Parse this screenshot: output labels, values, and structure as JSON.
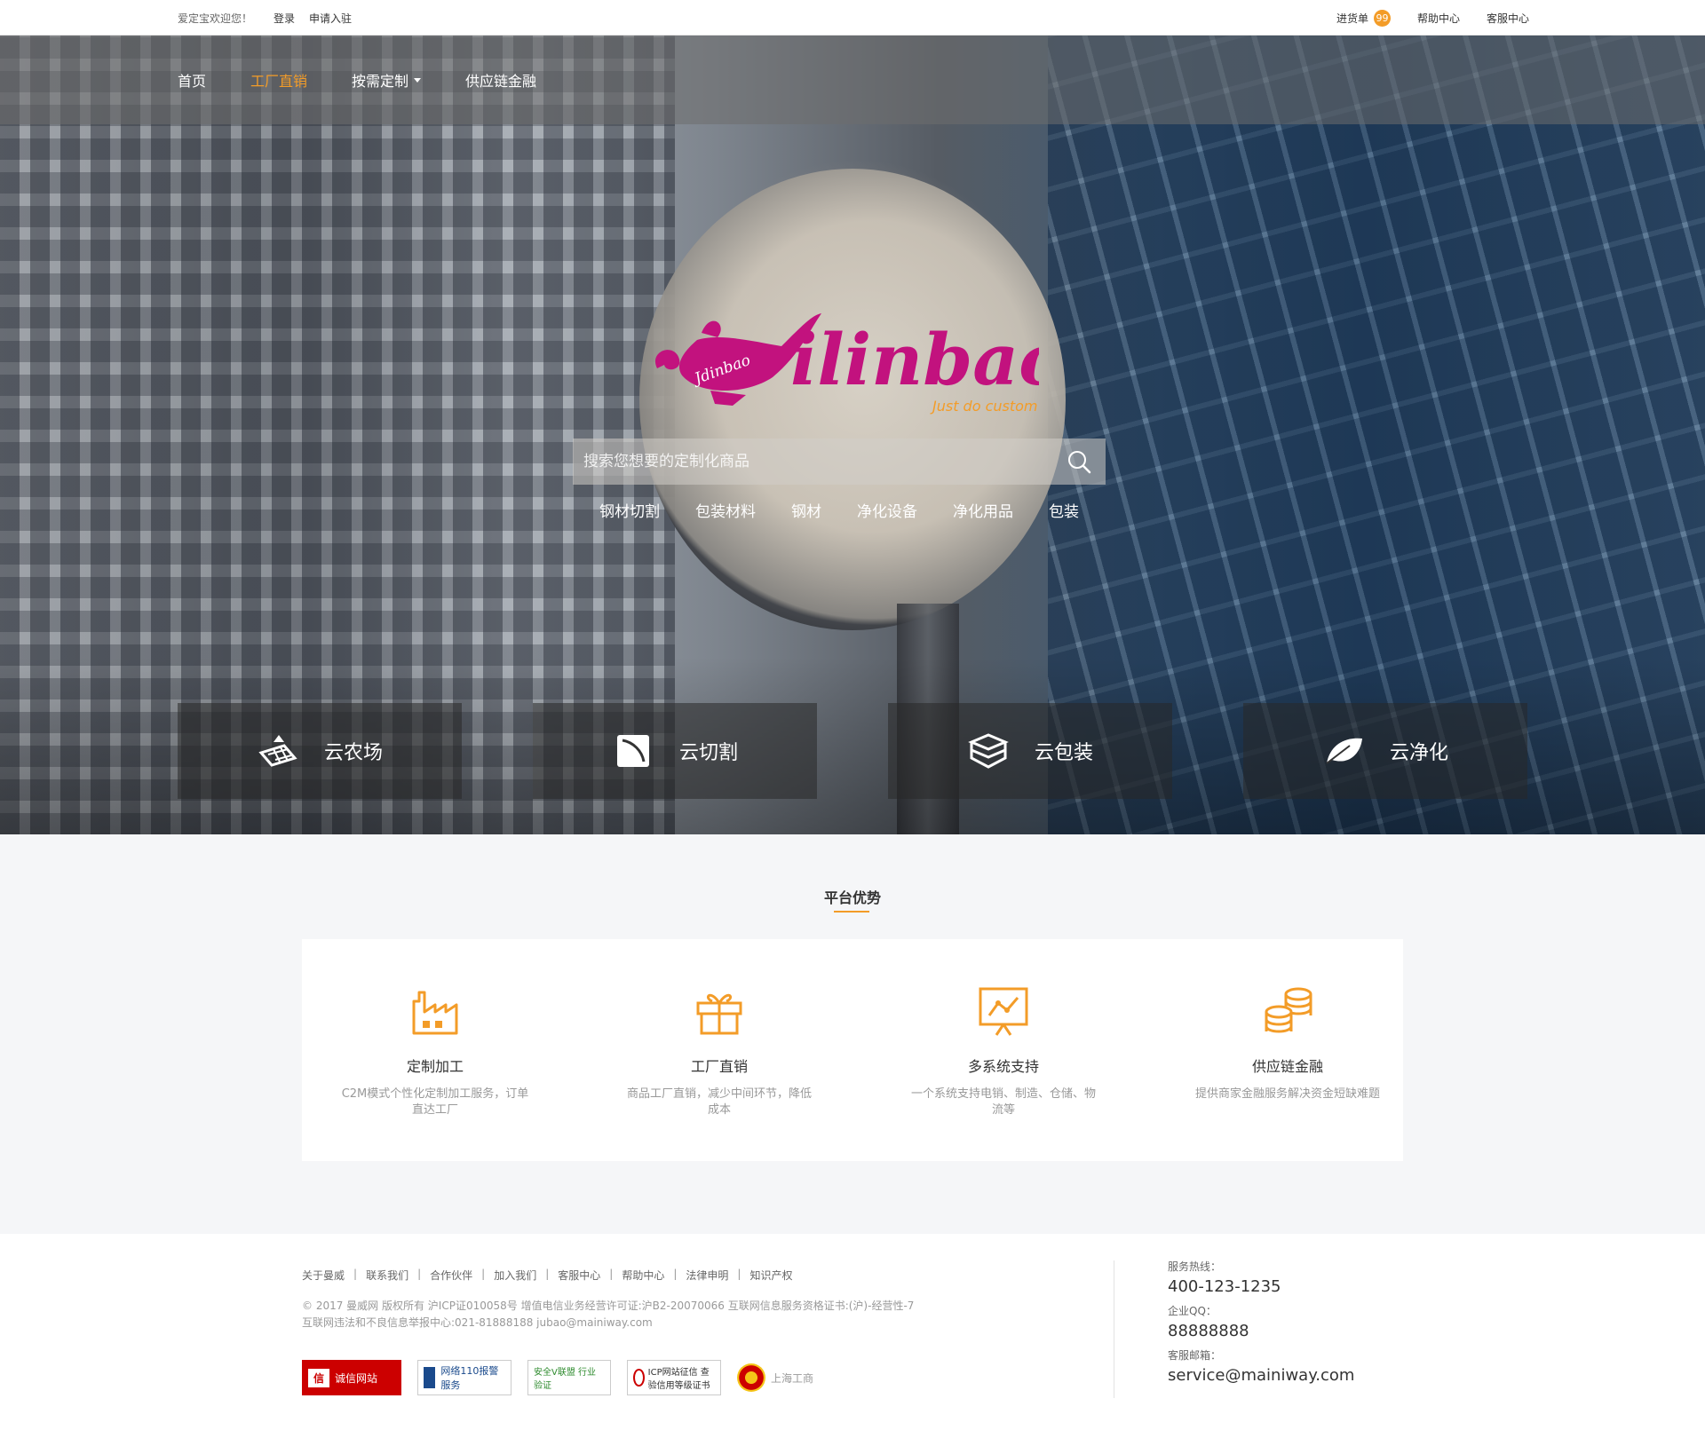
{
  "topbar": {
    "welcome": "爱定宝欢迎您！",
    "login": "登录",
    "apply": "申请入驻",
    "cart_label": "进货单",
    "cart_count": "99",
    "help": "帮助中心",
    "service": "客服中心"
  },
  "nav": {
    "items": [
      {
        "label": "首页"
      },
      {
        "label": "工厂直销"
      },
      {
        "label": "按需定制"
      },
      {
        "label": "供应链金融"
      }
    ]
  },
  "logo": {
    "brand": "ilinbao",
    "lamp_text": "Jdinbao",
    "slogan": "Just do custom"
  },
  "search": {
    "placeholder": "搜索您想要的定制化商品",
    "hotwords": [
      "钢材切割",
      "包装材料",
      "钢材",
      "净化设备",
      "净化用品",
      "包装"
    ]
  },
  "cards": [
    {
      "label": "云农场",
      "icon": "farm-icon"
    },
    {
      "label": "云切割",
      "icon": "cut-icon"
    },
    {
      "label": "云包装",
      "icon": "package-icon"
    },
    {
      "label": "云净化",
      "icon": "leaf-icon"
    }
  ],
  "advantages": {
    "title": "平台优势",
    "items": [
      {
        "title": "定制加工",
        "desc": "C2M模式个性化定制加工服务，订单直达工厂",
        "icon": "factory-icon"
      },
      {
        "title": "工厂直销",
        "desc": "商品工厂直销，减少中间环节，降低成本",
        "icon": "gift-icon"
      },
      {
        "title": "多系统支持",
        "desc": "一个系统支持电销、制造、仓储、物流等",
        "icon": "chart-board-icon"
      },
      {
        "title": "供应链金融",
        "desc": "提供商家金融服务解决资金短缺难题",
        "icon": "coins-icon"
      }
    ]
  },
  "footer": {
    "links": [
      "关于曼威",
      "联系我们",
      "合作伙伴",
      "加入我们",
      "客服中心",
      "帮助中心",
      "法律申明",
      "知识产权"
    ],
    "copyright": "© 2017 曼威网 版权所有  沪ICP证010058号   增值电信业务经营许可证:沪B2-20070066     互联网信息服务资格证书:(沪)-经营性-7",
    "report": "互联网违法和不良信息举报中心:021-81888188 jubao@mainiway.com",
    "badges": [
      "诚信网站",
      "网络110报警服务",
      "安全V联盟 行业验证",
      "ICP网站征信 查验信用等级证书",
      "上海工商"
    ],
    "hotline_label": "服务热线：",
    "hotline": "400-123-1235",
    "qq_label": "企业QQ：",
    "qq": "88888888",
    "email_label": "客服邮箱：",
    "email": "service@mainiway.com"
  },
  "colors": {
    "accent": "#f39c28",
    "brand_pink": "#c2127e"
  }
}
